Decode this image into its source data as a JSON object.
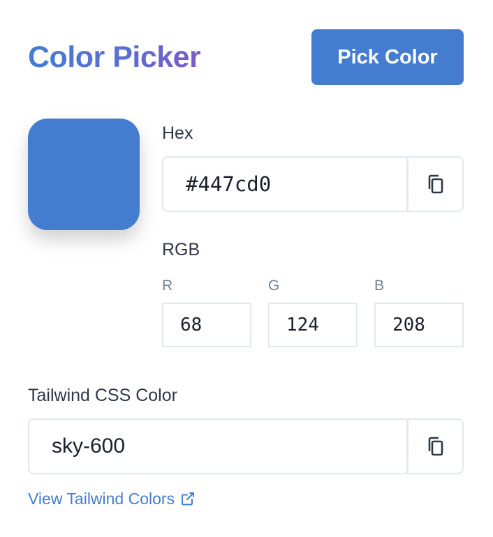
{
  "header": {
    "title": "Color Picker",
    "pick_button_label": "Pick Color"
  },
  "color": {
    "swatch": "#447cd0"
  },
  "hex": {
    "label": "Hex",
    "value": "#447cd0",
    "copy_icon": "copy-icon"
  },
  "rgb": {
    "label": "RGB",
    "channels": [
      {
        "label": "R",
        "value": "68"
      },
      {
        "label": "G",
        "value": "124"
      },
      {
        "label": "B",
        "value": "208"
      }
    ]
  },
  "tailwind": {
    "label": "Tailwind CSS Color",
    "value": "sky-600",
    "copy_icon": "copy-icon",
    "link_text": "View Tailwind Colors",
    "link_icon": "external-link-icon"
  },
  "colors": {
    "accent": "#447cd0",
    "border": "#e2e8f0",
    "muted_text": "#718096"
  }
}
